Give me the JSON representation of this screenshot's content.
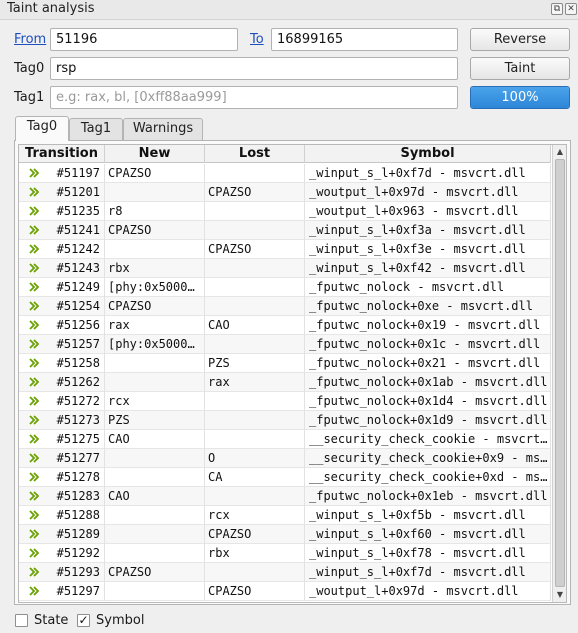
{
  "window": {
    "title": "Taint analysis",
    "float_glyph": "⧉",
    "close_glyph": "✕"
  },
  "range": {
    "from_label": "From",
    "from_value": "51196",
    "to_label": "To",
    "to_value": "16899165",
    "reverse_label": "Reverse"
  },
  "tag0": {
    "label": "Tag0",
    "value": "rsp",
    "button_label": "Taint"
  },
  "tag1": {
    "label": "Tag1",
    "placeholder": "e.g: rax, bl, [0xff88aa999]",
    "progress_text": "100%",
    "progress_fraction": 1.0
  },
  "tabs": [
    {
      "label": "Tag0",
      "active": true
    },
    {
      "label": "Tag1",
      "active": false
    },
    {
      "label": "Warnings",
      "active": false
    }
  ],
  "table": {
    "columns": [
      "Transition",
      "New",
      "Lost",
      "Symbol"
    ],
    "rows": [
      {
        "transition": "#51197",
        "new": "CPAZSO",
        "lost": "",
        "symbol": "_winput_s_l+0xf7d - msvcrt.dll"
      },
      {
        "transition": "#51201",
        "new": "",
        "lost": "CPAZSO",
        "symbol": "_woutput_l+0x97d - msvcrt.dll"
      },
      {
        "transition": "#51235",
        "new": "r8",
        "lost": "",
        "symbol": "_woutput_l+0x963 - msvcrt.dll"
      },
      {
        "transition": "#51241",
        "new": "CPAZSO",
        "lost": "",
        "symbol": "_winput_s_l+0xf3a - msvcrt.dll"
      },
      {
        "transition": "#51242",
        "new": "",
        "lost": "CPAZSO",
        "symbol": "_winput_s_l+0xf3e - msvcrt.dll"
      },
      {
        "transition": "#51243",
        "new": "rbx",
        "lost": "",
        "symbol": "_winput_s_l+0xf42 - msvcrt.dll"
      },
      {
        "transition": "#51249",
        "new": "[phy:0x5000…",
        "lost": "",
        "symbol": "_fputwc_nolock - msvcrt.dll"
      },
      {
        "transition": "#51254",
        "new": "CPAZSO",
        "lost": "",
        "symbol": "_fputwc_nolock+0xe - msvcrt.dll"
      },
      {
        "transition": "#51256",
        "new": "rax",
        "lost": "CAO",
        "symbol": "_fputwc_nolock+0x19 - msvcrt.dll"
      },
      {
        "transition": "#51257",
        "new": "[phy:0x5000…",
        "lost": "",
        "symbol": "_fputwc_nolock+0x1c - msvcrt.dll"
      },
      {
        "transition": "#51258",
        "new": "",
        "lost": "PZS",
        "symbol": "_fputwc_nolock+0x21 - msvcrt.dll"
      },
      {
        "transition": "#51262",
        "new": "",
        "lost": "rax",
        "symbol": "_fputwc_nolock+0x1ab - msvcrt.dll"
      },
      {
        "transition": "#51272",
        "new": "rcx",
        "lost": "",
        "symbol": "_fputwc_nolock+0x1d4 - msvcrt.dll"
      },
      {
        "transition": "#51273",
        "new": "PZS",
        "lost": "",
        "symbol": "_fputwc_nolock+0x1d9 - msvcrt.dll"
      },
      {
        "transition": "#51275",
        "new": "CAO",
        "lost": "",
        "symbol": "__security_check_cookie - msvcrt…"
      },
      {
        "transition": "#51277",
        "new": "",
        "lost": "O",
        "symbol": "__security_check_cookie+0x9 - ms…"
      },
      {
        "transition": "#51278",
        "new": "",
        "lost": "CA",
        "symbol": "__security_check_cookie+0xd - ms…"
      },
      {
        "transition": "#51283",
        "new": "CAO",
        "lost": "",
        "symbol": "_fputwc_nolock+0x1eb - msvcrt.dll"
      },
      {
        "transition": "#51288",
        "new": "",
        "lost": "rcx",
        "symbol": "_winput_s_l+0xf5b - msvcrt.dll"
      },
      {
        "transition": "#51289",
        "new": "",
        "lost": "CPAZSO",
        "symbol": "_winput_s_l+0xf60 - msvcrt.dll"
      },
      {
        "transition": "#51292",
        "new": "",
        "lost": "rbx",
        "symbol": "_winput_s_l+0xf78 - msvcrt.dll"
      },
      {
        "transition": "#51293",
        "new": "CPAZSO",
        "lost": "",
        "symbol": "_winput_s_l+0xf7d - msvcrt.dll"
      },
      {
        "transition": "#51297",
        "new": "",
        "lost": "CPAZSO",
        "symbol": "_woutput_l+0x97d - msvcrt.dll"
      }
    ]
  },
  "footer": {
    "state_label": "State",
    "state_checked": false,
    "symbol_label": "Symbol",
    "symbol_checked": true
  },
  "colors": {
    "progress": "#2e86d8",
    "link": "#1d4fbf",
    "arrow_icon": "#6aa000"
  }
}
